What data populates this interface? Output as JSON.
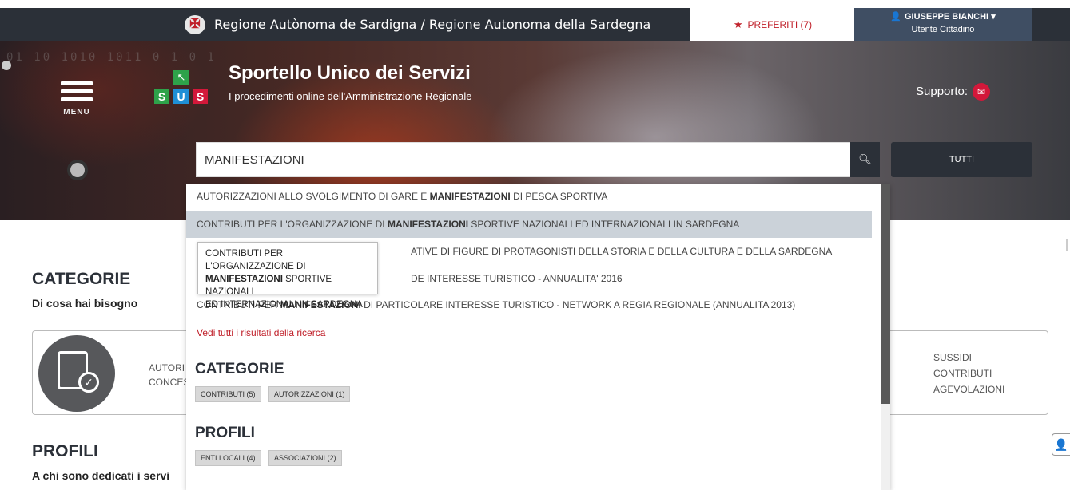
{
  "topbar": {
    "crest_icon": "sardinia-crest-icon",
    "region": "Regione Autònoma de Sardigna / Regione Autonoma della Sardegna",
    "favorites": "PREFERITI (7)",
    "user_name": "GIUSEPPE BIANCHI",
    "user_role": "Utente Cittadino"
  },
  "hero": {
    "menu_label": "MENU",
    "logo_letters": [
      "S",
      "U",
      "S"
    ],
    "title": "Sportello Unico dei Servizi",
    "subtitle": "I procedimenti online dell'Amministrazione Regionale",
    "support": "Supporto:",
    "bits": "01 10 1010 1011 0 1 0 1"
  },
  "search": {
    "value": "MANIFESTAZIONI",
    "all_button": "TUTTI"
  },
  "dropdown": {
    "suggestions": [
      {
        "pre": "AUTORIZZAZIONI ALLO SVOLGIMENTO DI GARE E ",
        "match": "MANIFESTAZIONI",
        "post": " DI PESCA SPORTIVA"
      },
      {
        "pre": "CONTRIBUTI PER L'ORGANIZZAZIONE DI ",
        "match": "MANIFESTAZIONI",
        "post": " SPORTIVE NAZIONALI ED INTERNAZIONALI IN SARDEGNA"
      },
      {
        "pre": "",
        "match": "",
        "post": "ATIVE DI FIGURE DI PROTAGONISTI DELLA STORIA E DELLA CULTURA E DELLA SARDEGNA"
      },
      {
        "pre": "",
        "match": "",
        "post": "DE INTERESSE TURISTICO - ANNUALITA' 2016"
      },
      {
        "pre": "CONTRIBUTI PER ",
        "match": "MANIFESTAZIONI",
        "post": " DI PARTICOLARE INTERESSE TURISTICO - NETWORK A REGIA REGIONALE (ANNUALITA'2013)"
      }
    ],
    "see_all": "Vedi tutti i risultati della ricerca",
    "categories_title": "CATEGORIE",
    "categories": [
      "CONTRIBUTI (5)",
      "AUTORIZZAZIONI (1)"
    ],
    "profiles_title": "PROFILI",
    "profiles": [
      "ENTI LOCALI (4)",
      "ASSOCIAZIONI (2)"
    ]
  },
  "tooltip": {
    "line1": "CONTRIBUTI PER L'ORGANIZZAZIONE DI",
    "bold": "MANIFESTAZIONI",
    "line2_rest": " SPORTIVE NAZIONALI",
    "line3": "ED INTERNAZIONALI IN SARDEGNA"
  },
  "page": {
    "categories_title": "CATEGORIE",
    "categories_sub": "Di cosa hai bisogno",
    "card_left_lines": [
      "AUTORI",
      "CONCES"
    ],
    "card_right_lines": [
      "SUSSIDI",
      "CONTRIBUTI",
      "AGEVOLAZIONI"
    ],
    "profiles_title": "PROFILI",
    "profiles_sub": "A chi sono dedicati i servi"
  },
  "colors": {
    "dark": "#2b3038",
    "accent_red": "#c0202a",
    "user_bg": "#3f4e63",
    "highlight_row": "#cbd2d9"
  }
}
